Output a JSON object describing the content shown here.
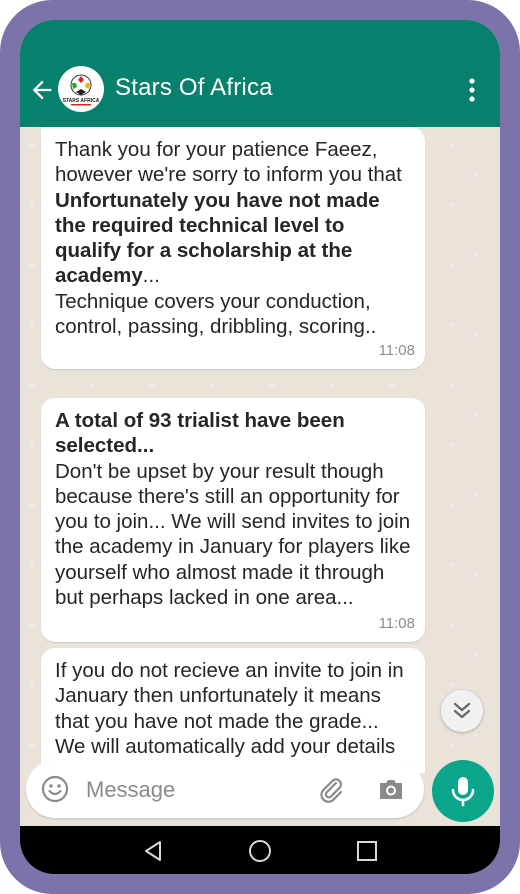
{
  "header": {
    "title": "Stars Of Africa",
    "avatar_logo_text": "STARS AFRICA"
  },
  "messages": [
    {
      "intro": "Thank you for your patience Faeez, however we're sorry to inform you that ",
      "bold": "Unfortunately you have not made the required technical level to qualify for a scholarship at the academy",
      "after_bold": "...",
      "detail": "Technique covers your conduction, control, passing, dribbling, scoring..",
      "time": "11:08"
    },
    {
      "bold": "A total of 93 trialist have been selected...",
      "body": "Don't be upset by your result though because there's still an opportunity for you to join... We will send invites to join the academy in January for players like yourself who almost made it through but perhaps lacked in one area...",
      "time": "11:08"
    },
    {
      "body": "If you do not recieve an invite to join in January then unfortunately it means that you have not made the grade...",
      "body2": "We will automatically add your details"
    }
  ],
  "composer": {
    "placeholder": "Message"
  },
  "icons": {
    "back": "arrow-left-icon",
    "menu": "more-vert-icon",
    "emoji": "emoji-icon",
    "attach": "paperclip-icon",
    "camera": "camera-icon",
    "mic": "mic-icon",
    "scroll": "chevron-double-down-icon"
  },
  "colors": {
    "header": "#07806d",
    "accent": "#0aa58a",
    "frame": "#7b73a9"
  }
}
